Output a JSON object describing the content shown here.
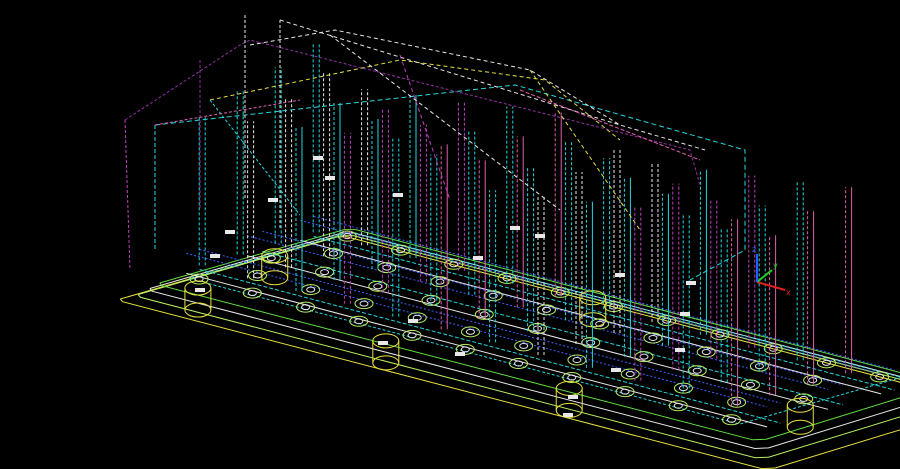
{
  "viewport": {
    "background": "#000000",
    "wire_colors": {
      "cyan": "#22d8e0",
      "white": "#e8e8e8",
      "magenta": "#c040c0",
      "pink": "#e060b0",
      "yellow": "#e8e040",
      "green": "#60e040",
      "lightgreen": "#b8f060",
      "purple": "#9030a0",
      "blue": "#4060ff",
      "red": "#e02020"
    }
  },
  "axis_triad": {
    "x_label": "x",
    "y_label": "y",
    "z_label": "z",
    "x_color": "#e02020",
    "y_color": "#20d020",
    "z_color": "#2060ff"
  }
}
